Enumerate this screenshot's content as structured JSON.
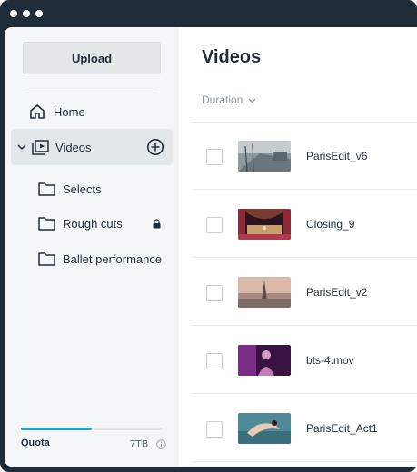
{
  "sidebar": {
    "upload_label": "Upload",
    "nav": [
      {
        "label": "Home",
        "icon": "home-icon"
      },
      {
        "label": "Videos",
        "icon": "video-folder-icon",
        "expanded": true,
        "selected": true
      }
    ],
    "folders": [
      {
        "label": "Selects",
        "icon": "folder-icon",
        "locked": false
      },
      {
        "label": "Rough cuts",
        "icon": "folder-icon",
        "locked": true
      },
      {
        "label": "Ballet performance",
        "icon": "folder-icon",
        "locked": false
      }
    ],
    "quota": {
      "label": "Quota",
      "value": "7TB",
      "used_fraction": 0.5
    }
  },
  "main": {
    "title": "Videos",
    "sort_label": "Duration",
    "rows": [
      {
        "title": "ParisEdit_v6",
        "thumb": "street-scene"
      },
      {
        "title": "Closing_9",
        "thumb": "theater-stage"
      },
      {
        "title": "ParisEdit_v2",
        "thumb": "eiffel-skyline"
      },
      {
        "title": "bts-4.mov",
        "thumb": "dancer-purple"
      },
      {
        "title": "ParisEdit_Act1",
        "thumb": "dancer-water"
      }
    ]
  },
  "colors": {
    "window_frame": "#1f2d3b",
    "sidebar_bg": "#f4f6f7",
    "selected_nav_bg": "#e2e7e9",
    "quota_fill": "#22a0ce",
    "muted_text": "#8d9aa3"
  }
}
